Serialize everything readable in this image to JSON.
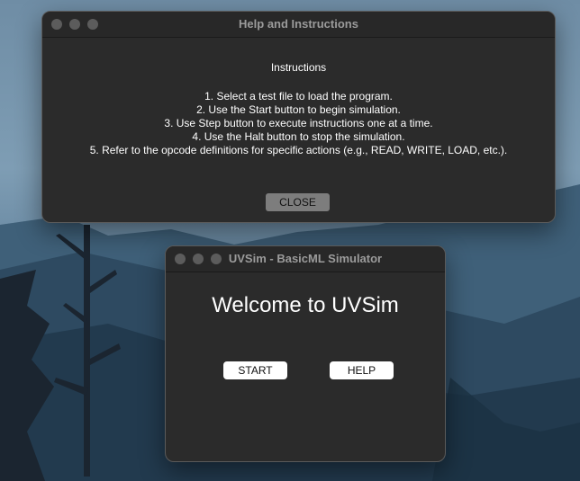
{
  "help_window": {
    "title": "Help and Instructions",
    "heading": "Instructions",
    "items": [
      "1. Select a test file to load the program.",
      "2. Use the Start button to begin simulation.",
      "3. Use Step button to execute instructions one at a time.",
      "4. Use the Halt button to stop the simulation.",
      "5. Refer to the opcode definitions for specific actions (e.g., READ, WRITE, LOAD, etc.)."
    ],
    "close_label": "CLOSE"
  },
  "main_window": {
    "title": "UVSim - BasicML Simulator",
    "welcome": "Welcome to UVSim",
    "start_label": "START",
    "help_label": "HELP"
  },
  "colors": {
    "window_bg": "#2b2b2b",
    "close_button_bg": "#7d7d7d",
    "button_bg": "#ffffff"
  }
}
